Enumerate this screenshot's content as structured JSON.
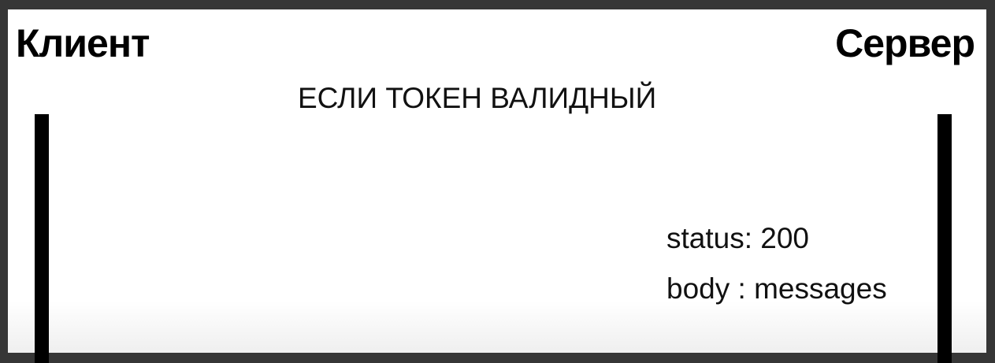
{
  "client_label": "Клиент",
  "server_label": "Сервер",
  "condition": "ЕСЛИ ТОКЕН ВАЛИДНЫЙ",
  "response": {
    "status": "status: 200",
    "body": "body : messages"
  }
}
